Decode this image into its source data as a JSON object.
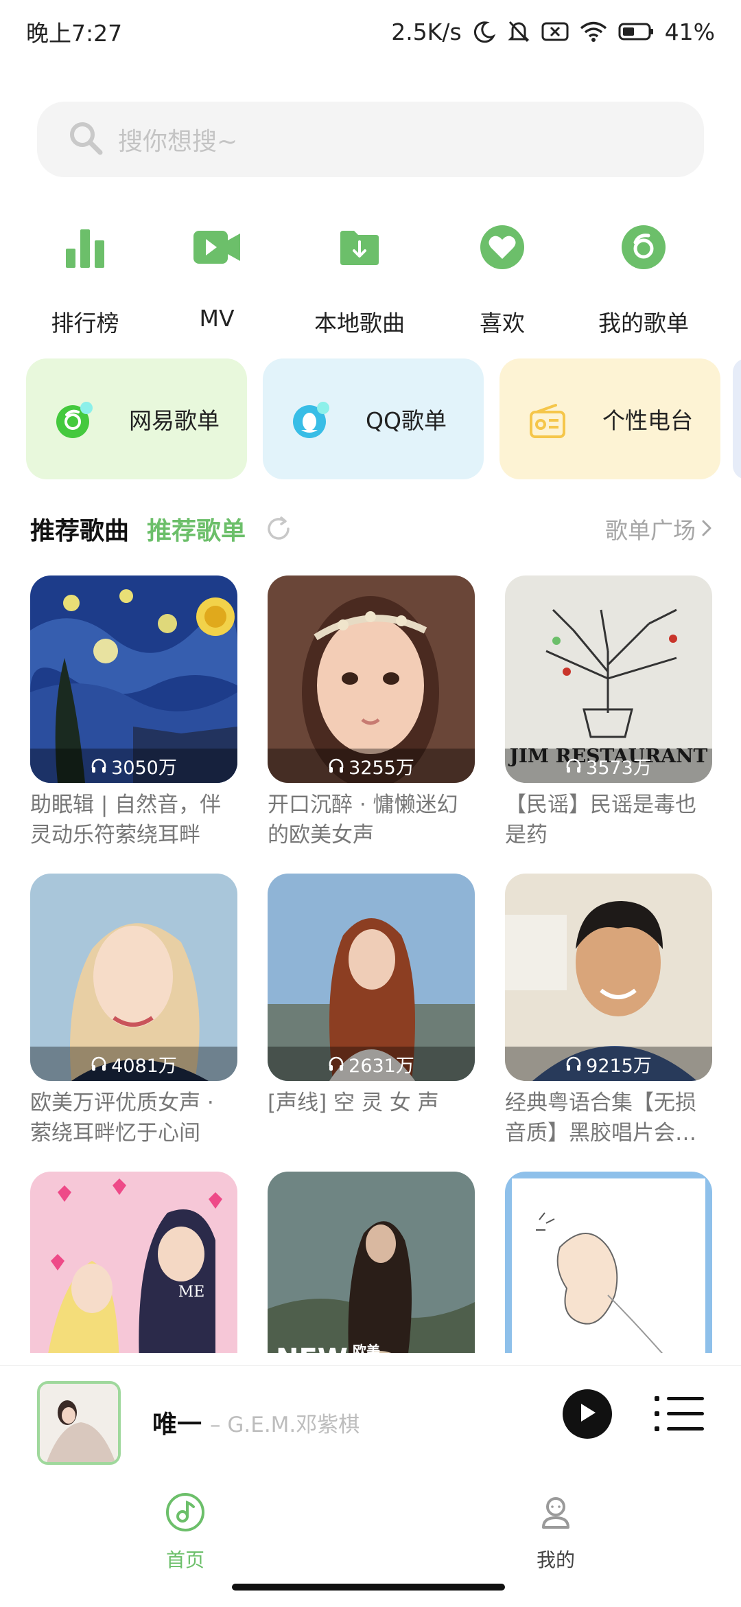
{
  "status_bar": {
    "time": "晚上7:27",
    "net_speed": "2.5K/s",
    "battery": "41%",
    "icons": [
      "moon-icon",
      "bell-off-icon",
      "sim-x-icon",
      "wifi-icon",
      "battery-icon"
    ]
  },
  "search": {
    "placeholder": "搜你想搜~",
    "icon": "search-icon"
  },
  "quick_actions": [
    {
      "label": "排行榜",
      "icon": "chart-bars-icon"
    },
    {
      "label": "MV",
      "icon": "video-camera-icon"
    },
    {
      "label": "本地歌曲",
      "icon": "folder-download-icon"
    },
    {
      "label": "喜欢",
      "icon": "heart-icon"
    },
    {
      "label": "我的歌单",
      "icon": "disc-icon"
    }
  ],
  "platforms": [
    {
      "label": "网易歌单",
      "icon": "netease-icon",
      "bg": "#e8f8dc"
    },
    {
      "label": "QQ歌单",
      "icon": "qq-penguin-icon",
      "bg": "#e2f3fa"
    },
    {
      "label": "个性电台",
      "icon": "radio-icon",
      "bg": "#fdf3d4"
    }
  ],
  "section": {
    "tab_active": "推荐歌曲",
    "tab_secondary": "推荐歌单",
    "plaza_link": "歌单广场"
  },
  "playlists": [
    {
      "title": "助眠辑 | 自然音，伴灵动乐符萦绕耳畔",
      "plays": "3050万"
    },
    {
      "title": "开口沉醉 · 慵懒迷幻的欧美女声",
      "plays": "3255万"
    },
    {
      "title": "【民谣】民谣是毒也是药",
      "plays": "3573万"
    },
    {
      "title": "欧美万评优质女声 · 萦绕耳畔忆于心间",
      "plays": "4081万"
    },
    {
      "title": "[声线] 空 灵 女 声",
      "plays": "2631万"
    },
    {
      "title": "经典粤语合集【无损音质】黑胶唱片会…",
      "plays": "9215万"
    },
    {
      "title": "",
      "plays": ""
    },
    {
      "title": "",
      "plays": ""
    },
    {
      "title": "",
      "plays": ""
    }
  ],
  "cover_text": {
    "restaurant": "JIM RESTAURANT",
    "me": "ME",
    "new": "NEW",
    "oumei": "欧美"
  },
  "player": {
    "title": "唯一",
    "artist": "– G.E.M.邓紫棋"
  },
  "nav": [
    {
      "label": "首页",
      "icon": "music-disc-icon",
      "active": true
    },
    {
      "label": "我的",
      "icon": "user-icon",
      "active": false
    }
  ],
  "colors": {
    "accent": "#6cbf6a",
    "text": "#222222",
    "muted": "#a6a6a6"
  }
}
